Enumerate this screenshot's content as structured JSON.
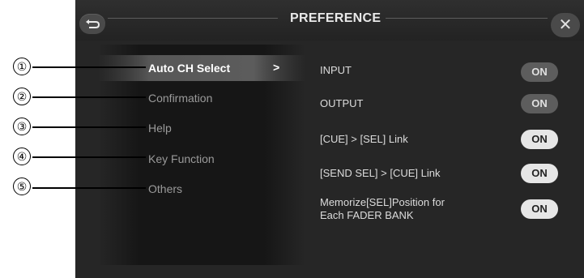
{
  "header": {
    "title": "PREFERENCE"
  },
  "sidebar": {
    "items": [
      {
        "label": "Auto CH Select",
        "arrow": ">",
        "selected": true
      },
      {
        "label": "Confirmation"
      },
      {
        "label": "Help"
      },
      {
        "label": "Key Function"
      },
      {
        "label": "Others"
      }
    ]
  },
  "settings": [
    {
      "label": "INPUT",
      "value": "ON"
    },
    {
      "label": "OUTPUT",
      "value": "ON"
    },
    {
      "label": "[CUE] > [SEL] Link",
      "value": "ON"
    },
    {
      "label": "[SEND SEL] > [CUE] Link",
      "value": "ON"
    },
    {
      "label_line1": "Memorize[SEL]Position for",
      "label_line2": "Each FADER BANK",
      "value": "ON"
    }
  ],
  "callouts": [
    "①",
    "②",
    "③",
    "④",
    "⑤"
  ]
}
